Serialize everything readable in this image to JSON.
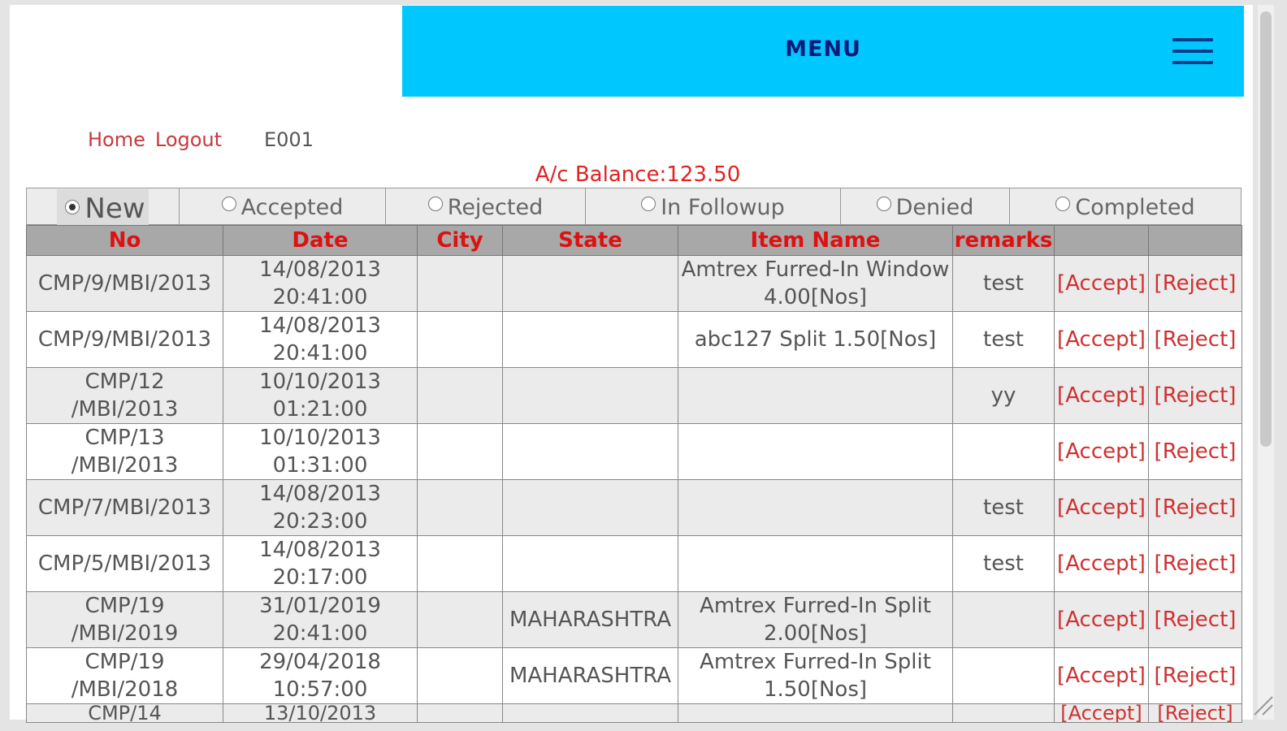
{
  "header": {
    "menu_label": "MENU"
  },
  "nav": {
    "home": "Home",
    "logout": "Logout",
    "user_id": "E001"
  },
  "balance_text": "A/c Balance:123.50",
  "tabs": [
    {
      "label": "New",
      "selected": true
    },
    {
      "label": "Accepted",
      "selected": false
    },
    {
      "label": "Rejected",
      "selected": false
    },
    {
      "label": "In Followup",
      "selected": false
    },
    {
      "label": "Denied",
      "selected": false
    },
    {
      "label": "Completed",
      "selected": false
    }
  ],
  "table": {
    "headers": [
      "No",
      "Date",
      "City",
      "State",
      "Item Name",
      "remarks",
      "",
      ""
    ],
    "accept_label": "[Accept]",
    "reject_label": "[Reject]",
    "rows": [
      {
        "no": "CMP/9/MBI/2013",
        "date": "14/08/2013 20:41:00",
        "city": "",
        "state": "",
        "item": "Amtrex Furred-In Window 4.00[Nos]",
        "remarks": "test"
      },
      {
        "no": "CMP/9/MBI/2013",
        "date": "14/08/2013 20:41:00",
        "city": "",
        "state": "",
        "item": "abc127 Split 1.50[Nos]",
        "remarks": "test"
      },
      {
        "no": "CMP/12 /MBI/2013",
        "date": "10/10/2013 01:21:00",
        "city": "",
        "state": "",
        "item": "",
        "remarks": "yy"
      },
      {
        "no": "CMP/13 /MBI/2013",
        "date": "10/10/2013 01:31:00",
        "city": "",
        "state": "",
        "item": "",
        "remarks": ""
      },
      {
        "no": "CMP/7/MBI/2013",
        "date": "14/08/2013 20:23:00",
        "city": "",
        "state": "",
        "item": "",
        "remarks": "test"
      },
      {
        "no": "CMP/5/MBI/2013",
        "date": "14/08/2013 20:17:00",
        "city": "",
        "state": "",
        "item": "",
        "remarks": "test"
      },
      {
        "no": "CMP/19 /MBI/2019",
        "date": "31/01/2019 20:41:00",
        "city": "",
        "state": "MAHARASHTRA",
        "item": "Amtrex Furred-In Split 2.00[Nos]",
        "remarks": ""
      },
      {
        "no": "CMP/19 /MBI/2018",
        "date": "29/04/2018 10:57:00",
        "city": "",
        "state": "MAHARASHTRA",
        "item": "Amtrex Furred-In Split 1.50[Nos]",
        "remarks": ""
      },
      {
        "no": "CMP/14",
        "date": "13/10/2013",
        "city": "",
        "state": "",
        "item": "",
        "remarks": ""
      }
    ]
  }
}
